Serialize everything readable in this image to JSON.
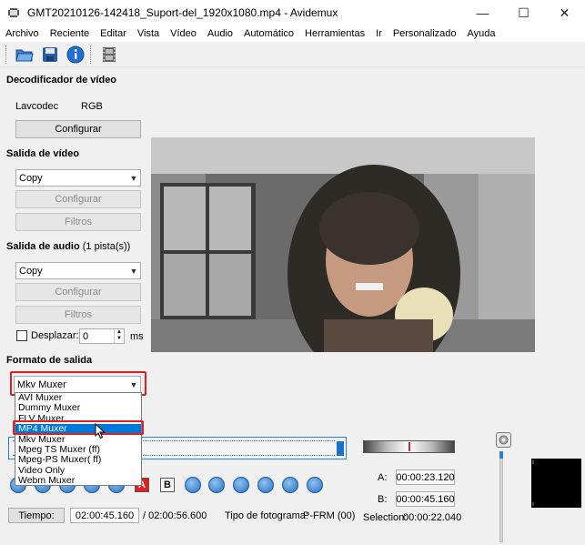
{
  "window": {
    "title": "GMT20210126-142418_Suport-del_1920x1080.mp4 - Avidemux",
    "minimize": "—",
    "maximize": "☐",
    "close": "✕"
  },
  "menu": [
    "Archivo",
    "Reciente",
    "Editar",
    "Vista",
    "Vídeo",
    "Audio",
    "Automático",
    "Herramientas",
    "Ir",
    "Personalizado",
    "Ayuda"
  ],
  "video_decoder": {
    "title": "Decodificador de vídeo",
    "codec": "Lavcodec",
    "colorspace": "RGB",
    "configure_label": "Configurar"
  },
  "video_output": {
    "title": "Salida de vídeo",
    "selected": "Copy",
    "configure_label": "Configurar",
    "filters_label": "Filtros"
  },
  "audio_output": {
    "title": "Salida de audio",
    "tracks": "(1 pista(s))",
    "selected": "Copy",
    "configure_label": "Configurar",
    "filters_label": "Filtros",
    "shift_label": "Desplazar:",
    "shift_value": "0",
    "shift_unit": "ms"
  },
  "output_format": {
    "title": "Formato de salida",
    "selected": "Mkv Muxer",
    "options": [
      "AVI Muxer",
      "Dummy Muxer",
      "FLV Muxer",
      "MP4 Muxer",
      "Mkv Muxer",
      "Mpeg TS Muxer (ff)",
      "Mpeg-PS Muxer( ff)",
      "Video Only",
      "Webm Muxer"
    ],
    "highlighted": "MP4 Muxer"
  },
  "controls": {
    "marker_a": "A",
    "marker_b": "B"
  },
  "markers": {
    "a_label": "A:",
    "a_time": "00:00:23.120",
    "b_label": "B:",
    "b_time": "00:00:45.160",
    "selection_label": "Selection:",
    "selection_time": "00:00:22.040"
  },
  "status": {
    "time_button": "Tiempo:",
    "current_time": "02:00:45.160",
    "total_time": "/ 02:00:56.600",
    "frame_type_label": "Tipo de fotograma:",
    "frame_type_value": "P-FRM (00)"
  },
  "colors": {
    "accent": "#0078d7",
    "highlight_red": "#e02020",
    "timeline_blue": "#2b7fd6"
  }
}
